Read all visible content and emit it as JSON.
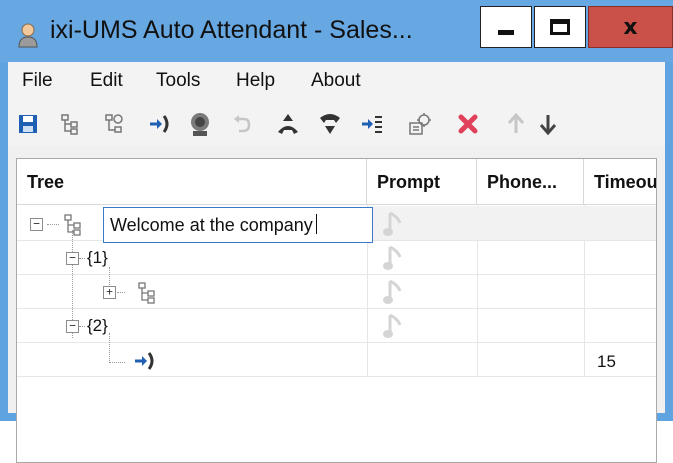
{
  "window": {
    "title": "ixi-UMS Auto Attendant - Sales...",
    "close_glyph": "x"
  },
  "menu": {
    "items": [
      "File",
      "Edit",
      "Tools",
      "Help",
      "About"
    ]
  },
  "toolbar": {
    "icons": [
      "save-icon",
      "tree-icon",
      "tree-settings-icon",
      "transfer-icon",
      "speaker-icon",
      "undo-icon",
      "pickup-icon",
      "hangup-icon",
      "queue-icon",
      "properties-icon",
      "delete-icon",
      "move-up-icon",
      "move-down-icon"
    ]
  },
  "grid": {
    "columns": [
      "Tree",
      "Prompt",
      "Phone...",
      "Timeou"
    ],
    "editing_value": "Welcome at the company",
    "rows": [
      {
        "label": "",
        "kind": "root",
        "expanded": true
      },
      {
        "label": "{1}",
        "kind": "branch",
        "expanded": true
      },
      {
        "label": "",
        "kind": "subtree",
        "expanded": false
      },
      {
        "label": "{2}",
        "kind": "branch",
        "expanded": true
      },
      {
        "label": "",
        "kind": "transfer",
        "timeout": "15"
      }
    ]
  },
  "colors": {
    "titlebar": "#67a7e2",
    "close_button": "#c9514a",
    "save_blue": "#1f5fb4",
    "delete_red": "#e0405a"
  }
}
